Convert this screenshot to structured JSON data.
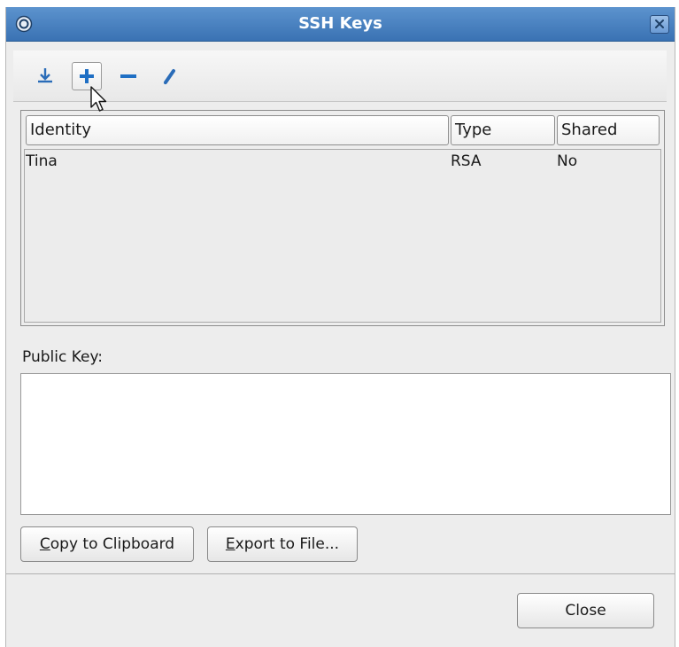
{
  "window": {
    "title": "SSH Keys",
    "menu_icon": "window-menu-icon",
    "close_icon": "close-icon"
  },
  "toolbar": {
    "buttons": [
      {
        "name": "import-key-button",
        "icon": "download-icon"
      },
      {
        "name": "add-key-button",
        "icon": "plus-icon"
      },
      {
        "name": "remove-key-button",
        "icon": "minus-icon"
      },
      {
        "name": "edit-key-button",
        "icon": "pencil-icon"
      }
    ]
  },
  "table": {
    "columns": [
      "Identity",
      "Type",
      "Shared"
    ],
    "rows": [
      {
        "identity": "Tina",
        "type": "RSA",
        "shared": "No"
      }
    ]
  },
  "public_key": {
    "label": "Public Key:",
    "value": ""
  },
  "actions": {
    "copy_mnemonic": "C",
    "copy_rest": "opy to Clipboard",
    "export_mnemonic": "E",
    "export_rest": "xport to File...",
    "close_label": "Close"
  },
  "colors": {
    "titlebar": "#4a82c2",
    "accent_blue": "#1f6fc4",
    "dialog_bg": "#ededed"
  }
}
